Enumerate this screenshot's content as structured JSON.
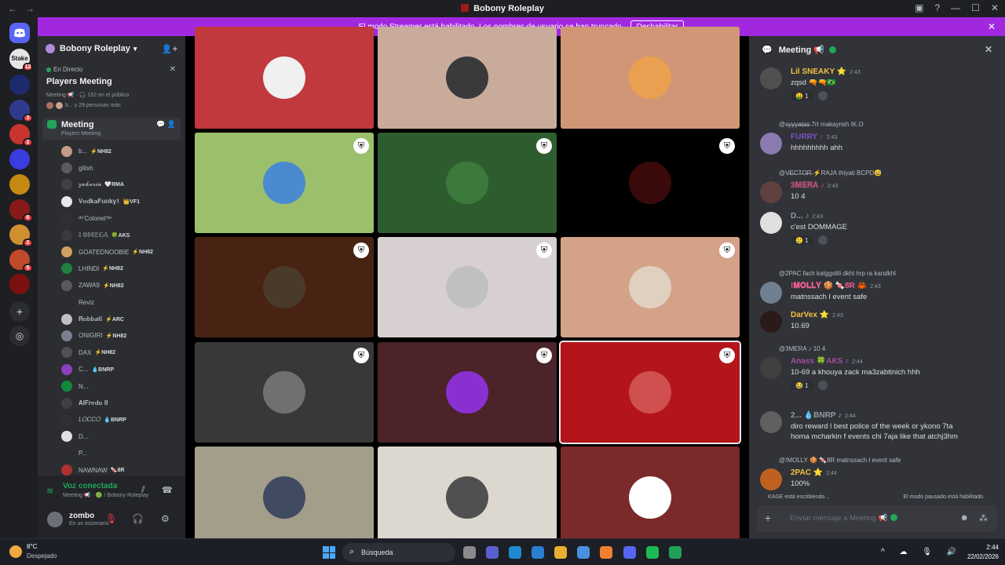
{
  "window": {
    "title": "Bobony Roleplay",
    "back": "←",
    "forward": "→",
    "minimize": "—",
    "maximize": "☐",
    "close": "✕",
    "inbox": "▣",
    "help": "?"
  },
  "banner": {
    "text": "El modo Streamer está habilitado. Los nombres de usuario se han truncado.",
    "button": "Deshabilitar",
    "close": "✕"
  },
  "guilds": [
    {
      "label": "Stake",
      "color": "#e6e6e6",
      "badge": "12"
    },
    {
      "label": "",
      "color": "#1d2a6e",
      "badge": ""
    },
    {
      "label": "",
      "color": "#303a8c",
      "badge": "3"
    },
    {
      "label": "",
      "color": "#c9342e",
      "badge": "2"
    },
    {
      "label": "",
      "color": "#3a3de0",
      "badge": ""
    },
    {
      "label": "",
      "color": "#c58a12",
      "badge": ""
    },
    {
      "label": "",
      "color": "#8a1a1a",
      "badge": "6"
    },
    {
      "label": "",
      "color": "#d09030",
      "badge": "2"
    },
    {
      "label": "",
      "color": "#c04a2a",
      "badge": "5"
    },
    {
      "label": "",
      "color": "#7b1010",
      "badge": ""
    }
  ],
  "server": {
    "name": "Bobony Roleplay"
  },
  "stage": {
    "live": "En Directo",
    "title": "Players Meeting",
    "meta": "Meeting 📢 · 🎧 152 en el público",
    "people": "b... y 29 personas más"
  },
  "voice_channel": {
    "name": "Meeting",
    "sub": "Players Meeting"
  },
  "members": [
    {
      "name": "b...",
      "tag": "⚡NH82",
      "color": "#c49a88"
    },
    {
      "name": "glitxh",
      "tag": "",
      "color": "#5a5a5a"
    },
    {
      "name": "𝔃𝓪𝓴𝓪𝓻𝓲𝓪",
      "tag": "🤍RMA",
      "color": "#404040"
    },
    {
      "name": "𝐕𝐨𝐝𝐤𝐚𝐅𝐮𝐧𝐤𝐲𝟏",
      "tag": "👑VF1",
      "color": "#e8e8e8"
    },
    {
      "name": "ᵈᵉ'Colonel'ᵈᵉ",
      "tag": "",
      "color": "#303030"
    },
    {
      "name": "𝕀 𝕆𝕄𝔼𝔾𝔸",
      "tag": "🍀AKS",
      "color": "#3a3a3a"
    },
    {
      "name": "GOATEDNOOBIE",
      "tag": "⚡NH82",
      "color": "#d0a060"
    },
    {
      "name": "LHINDI",
      "tag": "⚡NH82",
      "color": "#208040"
    },
    {
      "name": "ZAWA9",
      "tag": "⚡NH82",
      "color": "#5a5a5a"
    },
    {
      "name": "Reviz",
      "tag": "",
      "color": "#2b2d31"
    },
    {
      "name": "𝐑𝐨𝐛𝐛𝐚𝐭𝐢",
      "tag": "⚡ARC",
      "color": "#c0c0c0"
    },
    {
      "name": "ONIGIRI",
      "tag": "⚡NH82",
      "color": "#7a8090"
    },
    {
      "name": "DAX",
      "tag": "⚡NH82",
      "color": "#505050"
    },
    {
      "name": "C...",
      "tag": "💧BNRP",
      "color": "#8a40c0"
    },
    {
      "name": "N...",
      "tag": "",
      "color": "#0f8a3a"
    },
    {
      "name": "𝐀𝐥𝐅𝐫𝐞𝐝𝐨 𝐈𝐈",
      "tag": "",
      "color": "#404040"
    },
    {
      "name": "𝐿𝑂𝐶𝐶𝑂",
      "tag": "💧BNRP",
      "color": "#303030"
    },
    {
      "name": "D...",
      "tag": "",
      "color": "#e0e0e0"
    },
    {
      "name": "P...",
      "tag": "",
      "color": "#2b2d31"
    },
    {
      "name": "NAWNAW",
      "tag": "🍬8R",
      "color": "#b03030"
    }
  ],
  "voice": {
    "status": "Voz conectada",
    "path": "Meeting 📢 · 🟢 / Bobony Roleplay"
  },
  "user": {
    "name": "zombo",
    "status": "En un escenario"
  },
  "tiles": [
    {
      "color": "#c1383d",
      "avatar": "#f0f0f0",
      "shield": false
    },
    {
      "color": "#c9ab9c",
      "avatar": "#3a3a3a",
      "shield": false
    },
    {
      "color": "#d09676",
      "avatar": "#e9a050",
      "shield": false
    },
    {
      "color": "#9bbf6b",
      "avatar": "#4a8bd0",
      "shield": true
    },
    {
      "color": "#2d5d2f",
      "avatar": "#3b7a3a",
      "shield": true
    },
    {
      "color": "#000000",
      "avatar": "#3a0a0a",
      "shield": true
    },
    {
      "color": "#482212",
      "avatar": "#4a3a2a",
      "shield": true
    },
    {
      "color": "#d8d0d0",
      "avatar": "#c0c0c0",
      "shield": true
    },
    {
      "color": "#d4a289",
      "avatar": "#e0d0c0",
      "shield": true
    },
    {
      "color": "#383838",
      "avatar": "#707070",
      "shield": true
    },
    {
      "color": "#4b2329",
      "avatar": "#8a30d0",
      "shield": true
    },
    {
      "color": "#b3151b",
      "avatar": "#d05050",
      "shield": true
    },
    {
      "color": "#a29e8a",
      "avatar": "#404a60",
      "shield": false
    },
    {
      "color": "#dcd8d0",
      "avatar": "#505050",
      "shield": false
    },
    {
      "color": "#7a2a2a",
      "avatar": "#ffffff",
      "shield": false
    }
  ],
  "chat": {
    "title": "Meeting 📢",
    "messages": [
      {
        "author": "Lil SNEAKY ⭐",
        "author_color": "#f0c040",
        "time": "2:43",
        "text": "zqsd 🔫🔫🇧🇷",
        "reply": "",
        "react": "🤑 1",
        "avatar": "#505050"
      },
      {
        "author": "FURRY ♪",
        "author_color": "#7b4fc8",
        "time": "2:43",
        "text": "hhhhhhhhh ahh",
        "reply": "@s̶y̶y̶y̶a̶t̶a̶s̶ 7rt makaynsh IK.O",
        "react": "",
        "avatar": "#8a7ab0"
      },
      {
        "author": "𝟑𝐌𝐄𝐑𝐀 ♪",
        "author_color": "#b05070",
        "time": "2:43",
        "text": "10 4",
        "reply": "@V̶E̶C̶T̶O̶R̶ ⚡RAJA  thiyati BCPD😅",
        "react": "",
        "avatar": "#604040"
      },
      {
        "author": "D... ♪",
        "author_color": "#949ba4",
        "time": "2:43",
        "text": "c'est DOMMAGE",
        "reply": "",
        "react": "🥲 1",
        "avatar": "#e0e0e0"
      },
      {
        "author": "!𝐌𝐎𝐋𝐋𝐘 🍪 🍬8R 🦀",
        "author_color": "#f06090",
        "time": "2:43",
        "text": "matnssach l event safe",
        "reply": "@2PAC fach katggolili dkhl hrp ra kandkhl",
        "react": "",
        "avatar": "#708090"
      },
      {
        "author": "DarVex ⭐",
        "author_color": "#f0c040",
        "time": "2:43",
        "text": "10.69",
        "reply": "",
        "react": "",
        "avatar": "#2a1a1a"
      },
      {
        "author": "Anass 🍀AKS ♪",
        "author_color": "#a050a0",
        "time": "2:44",
        "text": "10-69 a khouya zack ma3zabtinich hhh",
        "reply": "@3MERA ♪  10 4",
        "react": "😂 1",
        "avatar": "#404040"
      },
      {
        "author": "2... 💧BNRP ♪",
        "author_color": "#949ba4",
        "time": "2:44",
        "text": "diro reward l best police of the week or ykono 7ta",
        "text2": "homa mcharkin f events chi 7aja like that atchj3hm",
        "reply": "",
        "react": "",
        "avatar": "#606060"
      },
      {
        "author": "2PAC ⭐",
        "author_color": "#f0c040",
        "time": "2:44",
        "text": "100%",
        "reply": "@!MOLLY 🍪 🍬8R  matnssach l event safe",
        "react": "",
        "avatar": "#c06020"
      }
    ],
    "typing": "KAGE está escribiendo...",
    "paused": "El modo pausado está habilitado.",
    "placeholder": "Enviar mensaje a Meeting 📢"
  },
  "taskbar": {
    "temp": "8°C",
    "weather": "Despejado",
    "search": "Búsqueda",
    "time": "2:44",
    "date": "22/02/2026",
    "apps": [
      "#8a8a8a",
      "#5a60d0",
      "#1f8ad0",
      "#2a7fd0",
      "#e8b030",
      "#4a90e0",
      "#f08030",
      "#5865f2",
      "#1db954",
      "#22a05a"
    ]
  }
}
